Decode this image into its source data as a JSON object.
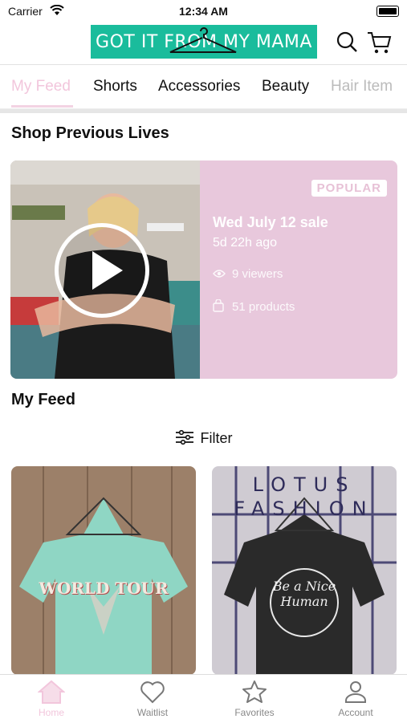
{
  "status": {
    "carrier": "Carrier",
    "time": "12:34 AM"
  },
  "header": {
    "logo_text": "GOT IT FROM MY MAMA"
  },
  "tabs": [
    {
      "label": "My Feed",
      "active": true
    },
    {
      "label": "Shorts"
    },
    {
      "label": "Accessories"
    },
    {
      "label": "Beauty"
    },
    {
      "label": "Hair Item"
    }
  ],
  "previous_lives": {
    "title": "Shop Previous Lives",
    "badge": "POPULAR",
    "sale_title": "Wed July 12 sale",
    "ago": "5d 22h ago",
    "viewers": "9 viewers",
    "products": "51 products"
  },
  "feed": {
    "title": "My Feed",
    "filter_label": "Filter"
  },
  "products": [
    {
      "shirt_text": "WORLD TOUR",
      "color": "#8fd6c4"
    },
    {
      "shirt_text": "Be a Nice Human",
      "color": "#2a2a2a",
      "bg_text": "LOTUS FASHION"
    }
  ],
  "tabbar": [
    {
      "label": "Home",
      "icon": "home-icon",
      "active": true
    },
    {
      "label": "Waitlist",
      "icon": "heart-icon"
    },
    {
      "label": "Favorites",
      "icon": "star-icon"
    },
    {
      "label": "Account",
      "icon": "person-icon"
    }
  ],
  "colors": {
    "brand": "#1abc9c",
    "accent": "#f2c6dc",
    "card_bg": "#e8c8dc"
  }
}
